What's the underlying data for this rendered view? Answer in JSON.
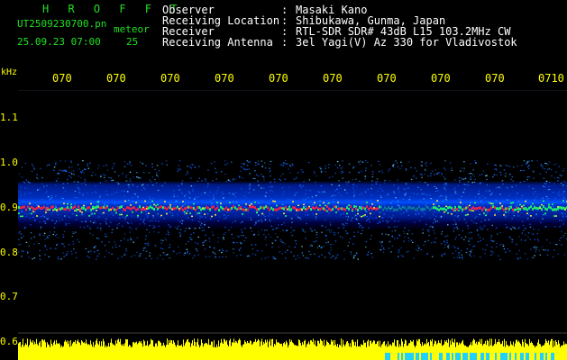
{
  "header": {
    "brand": "H R O F F T",
    "filename": "UT2509230700.pn",
    "meteor_label": "meteor",
    "date_time": "25.09.23 07:00",
    "meteor_count": "25"
  },
  "meta": [
    {
      "label": "Observer",
      "value": "Masaki Kano"
    },
    {
      "label": "Receiving Location",
      "value": "Shibukawa, Gunma, Japan"
    },
    {
      "label": "Receiver",
      "value": "RTL-SDR SDR# 43dB L15 103.2MHz CW"
    },
    {
      "label": "Receiving Antenna",
      "value": "3el Yagi(V) Az 330 for Vladivostok"
    }
  ],
  "axis": {
    "khz_label": "kHz",
    "time_ticks": [
      "070",
      "070",
      "070",
      "070",
      "070",
      "070",
      "070",
      "070",
      "070",
      "0710"
    ],
    "freq_ticks": [
      "1.1",
      "1.0",
      "0.9",
      "0.8",
      "0.7",
      "0.6"
    ]
  },
  "colors": {
    "background": "#000000",
    "spectrogram_base": "#00007a",
    "signal_hot": "#ff2040",
    "signal_mid": "#20ff60",
    "bars": "#ffff00",
    "bars_low": "#20d0ff",
    "text_green": "#20e020",
    "text_white": "#ffffff",
    "tick_yellow": "#ffff00"
  }
}
